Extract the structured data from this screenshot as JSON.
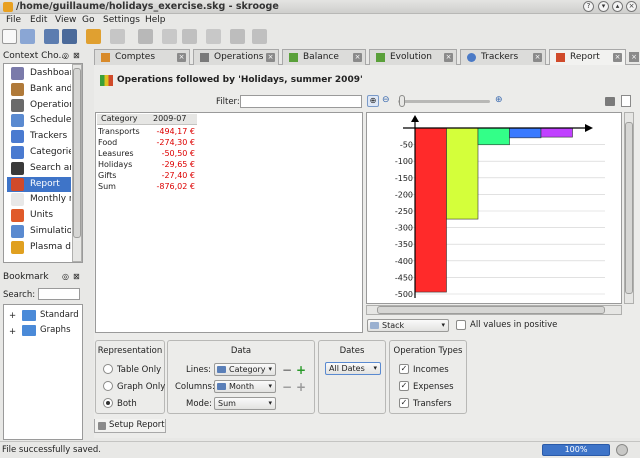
{
  "window": {
    "title": "/home/guillaume/holidays_exercise.skg - skrooge"
  },
  "menu": [
    "File",
    "Edit",
    "View",
    "Go",
    "Settings",
    "Help"
  ],
  "tabs": [
    {
      "label": "Comptes",
      "icon": "accounts-icon"
    },
    {
      "label": "Operations",
      "icon": "operations-icon"
    },
    {
      "label": "Balance",
      "icon": "balance-icon"
    },
    {
      "label": "Evolution",
      "icon": "evolution-icon"
    },
    {
      "label": "Trackers",
      "icon": "trackers-icon"
    },
    {
      "label": "Report",
      "icon": "report-icon"
    }
  ],
  "context": {
    "title": "Context Cho...",
    "items": [
      "Dashboard",
      "Bank and A...",
      "Operations",
      "Scheduled",
      "Trackers",
      "Categories",
      "Search and...",
      "Report",
      "Monthly re...",
      "Units",
      "Simulation",
      "Plasma da..."
    ],
    "selected": "Report"
  },
  "bookmark": {
    "title": "Bookmark",
    "search_label": "Search:",
    "items": [
      "Standard",
      "Graphs"
    ]
  },
  "report": {
    "title": "Operations followed by 'Holidays, summer 2009'",
    "filter_label": "Filter:",
    "table_headers": [
      "Category",
      "2009-07"
    ],
    "rows": [
      {
        "category": "Transports",
        "value": "-494,17 €"
      },
      {
        "category": "Food",
        "value": "-274,30 €"
      },
      {
        "category": "Leasures",
        "value": "-50,50 €"
      },
      {
        "category": "Holidays",
        "value": "-29,65 €"
      },
      {
        "category": "Gifts",
        "value": "-27,40 €"
      },
      {
        "category": "Sum",
        "value": "-876,02 €"
      }
    ],
    "graph_mode": "Stack",
    "all_positive_label": "All values in positive"
  },
  "chart_data": {
    "type": "bar",
    "stacked_layout": "stepped",
    "categories": [
      "Transports",
      "Food",
      "Leasures",
      "Holidays",
      "Gifts"
    ],
    "values": [
      -494.17,
      -274.3,
      -50.5,
      -29.65,
      -27.4
    ],
    "colors": [
      "#ff2a2a",
      "#d4ff3a",
      "#33ff88",
      "#3a7aff",
      "#c040ff"
    ],
    "yticks": [
      "-50",
      "-100",
      "-150",
      "-200",
      "-250",
      "-300",
      "-350",
      "-400",
      "-450",
      "-500"
    ],
    "ylim": [
      -500,
      0
    ]
  },
  "setup": {
    "representation": {
      "title": "Representation",
      "options": [
        "Table Only",
        "Graph Only",
        "Both"
      ],
      "selected": "Both"
    },
    "data": {
      "title": "Data",
      "lines_label": "Lines:",
      "lines_value": "Category",
      "columns_label": "Columns:",
      "columns_value": "Month",
      "mode_label": "Mode:",
      "mode_value": "Sum"
    },
    "dates": {
      "title": "Dates",
      "value": "All Dates"
    },
    "op_types": {
      "title": "Operation Types",
      "options": [
        "Incomes",
        "Expenses",
        "Transfers"
      ]
    },
    "tab_label": "Setup Report"
  },
  "status": {
    "message": "File successfully saved.",
    "progress": "100%"
  }
}
